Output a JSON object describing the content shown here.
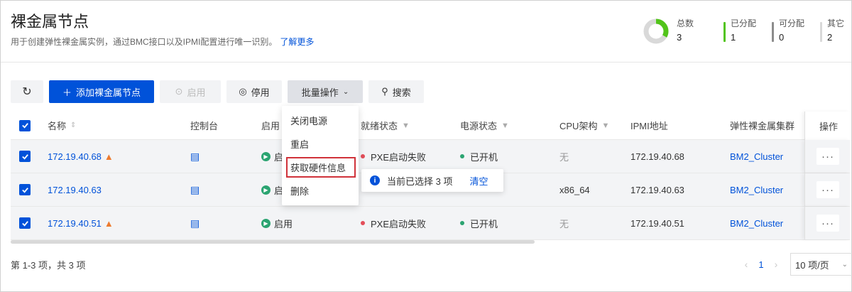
{
  "header": {
    "title": "裸金属节点",
    "description": "用于创建弹性裸金属实例，通过BMC接口以及IPMI配置进行唯一识别。",
    "learn_more": "了解更多"
  },
  "stats": {
    "total": {
      "label": "总数",
      "value": "3"
    },
    "items": [
      {
        "label": "已分配",
        "value": "1",
        "color": "#52c41a"
      },
      {
        "label": "可分配",
        "value": "0",
        "color": "#8c8c8c"
      },
      {
        "label": "其它",
        "value": "2",
        "color": "#d9d9d9"
      }
    ],
    "donut_allocated_fraction": 0.333
  },
  "toolbar": {
    "add_label": "添加裸金属节点",
    "enable_label": "启用",
    "disable_label": "停用",
    "batch_label": "批量操作",
    "search_label": "搜索"
  },
  "table": {
    "columns": {
      "name": "名称",
      "console": "控制台",
      "enabled": "启用",
      "ready": "就绪状态",
      "power": "电源状态",
      "cpu": "CPU架构",
      "ipmi": "IPMI地址",
      "cluster": "弹性裸金属集群",
      "ops": "操作"
    },
    "rows": [
      {
        "name": "172.19.40.68",
        "warn": true,
        "enabled": "启",
        "ready": "PXE启动失败",
        "power": "已开机",
        "cpu": "无",
        "ipmi": "172.19.40.68",
        "cluster": "BM2_Cluster"
      },
      {
        "name": "172.19.40.63",
        "warn": false,
        "enabled": "启",
        "ready": "",
        "power": "",
        "cpu": "x86_64",
        "ipmi": "172.19.40.63",
        "cluster": "BM2_Cluster"
      },
      {
        "name": "172.19.40.51",
        "warn": true,
        "enabled": "启用",
        "ready": "PXE启动失败",
        "power": "已开机",
        "cpu": "无",
        "ipmi": "172.19.40.51",
        "cluster": "BM2_Cluster"
      }
    ],
    "more_glyph": "···"
  },
  "batch_menu": {
    "items": [
      "关闭电源",
      "重启",
      "获取硬件信息",
      "删除"
    ]
  },
  "selection": {
    "text": "当前已选择 3 项",
    "clear": "清空"
  },
  "footer": {
    "summary": "第 1-3 项，共 3 项",
    "page": "1",
    "page_size": "10 项/页"
  }
}
